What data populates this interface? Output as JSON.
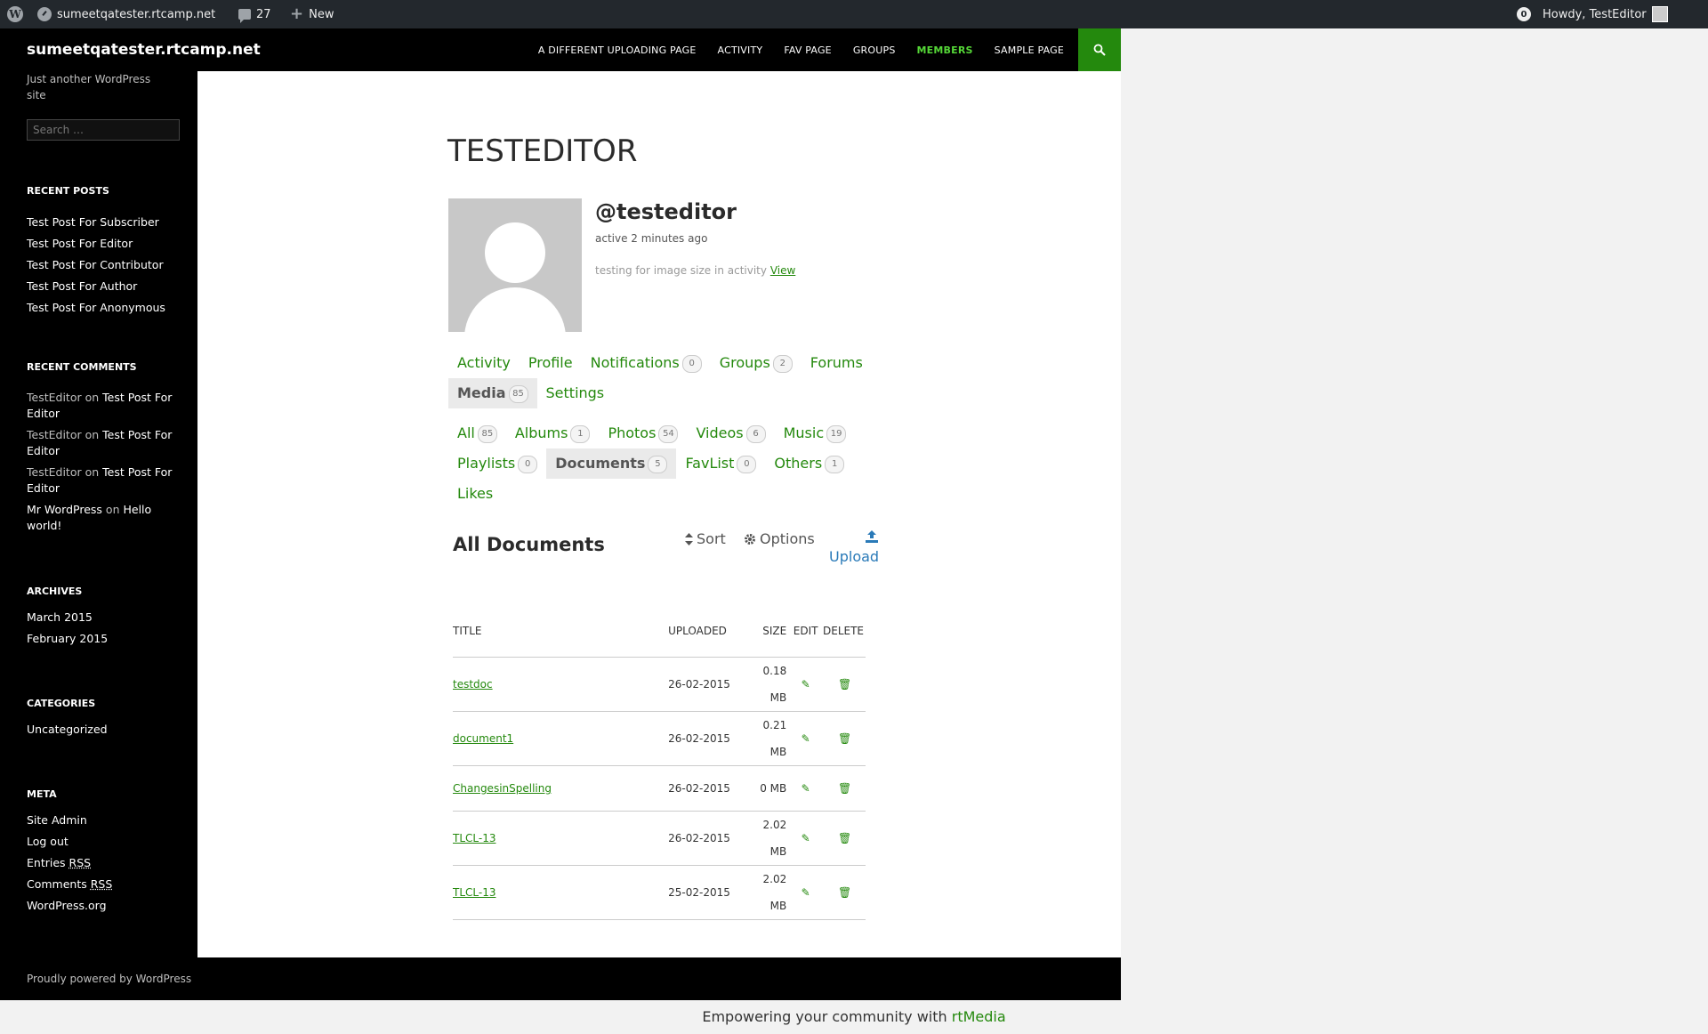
{
  "adminbar": {
    "site_name": "sumeetqatester.rtcamp.net",
    "comments_count": "27",
    "new_label": "New",
    "notifications_count": "0",
    "howdy": "Howdy, TestEditor"
  },
  "header": {
    "site_title": "sumeetqatester.rtcamp.net",
    "nav": [
      "A DIFFERENT UPLOADING PAGE",
      "ACTIVITY",
      "FAV PAGE",
      "GROUPS",
      "MEMBERS",
      "SAMPLE PAGE"
    ],
    "active_nav": "MEMBERS"
  },
  "sidebar": {
    "tagline": "Just another WordPress site",
    "search_placeholder": "Search …",
    "recent_posts_title": "RECENT POSTS",
    "recent_posts": [
      "Test Post For Subscriber",
      "Test Post For Editor",
      "Test Post For Contributor",
      "Test Post For Author",
      "Test Post For Anonymous"
    ],
    "recent_comments_title": "RECENT COMMENTS",
    "recent_comments": [
      {
        "author": "TestEditor",
        "on": "on",
        "post": "Test Post For Editor"
      },
      {
        "author": "TestEditor",
        "on": "on",
        "post": "Test Post For Editor"
      },
      {
        "author": "TestEditor",
        "on": "on",
        "post": "Test Post For Editor"
      },
      {
        "author": "Mr WordPress",
        "on": "on",
        "post": "Hello world!"
      }
    ],
    "archives_title": "ARCHIVES",
    "archives": [
      "March 2015",
      "February 2015"
    ],
    "categories_title": "CATEGORIES",
    "categories": [
      "Uncategorized"
    ],
    "meta_title": "META",
    "meta": {
      "site_admin": "Site Admin",
      "log_out": "Log out",
      "entries": "Entries",
      "comments": "Comments",
      "rss": "RSS",
      "wordpress_org": "WordPress.org"
    }
  },
  "profile": {
    "page_title": "TESTEDITOR",
    "username": "@testeditor",
    "activity_time": "active 2 minutes ago",
    "latest_update": "testing for image size in activity",
    "view_link": "View"
  },
  "main_tabs": [
    {
      "label": "Activity"
    },
    {
      "label": "Profile"
    },
    {
      "label": "Notifications",
      "count": "0"
    },
    {
      "label": "Groups",
      "count": "2"
    },
    {
      "label": "Forums"
    },
    {
      "label": "Media",
      "count": "85",
      "current": true
    },
    {
      "label": "Settings"
    }
  ],
  "media_tabs": [
    {
      "label": "All",
      "count": "85"
    },
    {
      "label": "Albums",
      "count": "1"
    },
    {
      "label": "Photos",
      "count": "54"
    },
    {
      "label": "Videos",
      "count": "6"
    },
    {
      "label": "Music",
      "count": "19"
    },
    {
      "label": "Playlists",
      "count": "0"
    },
    {
      "label": "Documents",
      "count": "5",
      "current": true
    },
    {
      "label": "FavList",
      "count": "0"
    },
    {
      "label": "Others",
      "count": "1"
    },
    {
      "label": "Likes"
    }
  ],
  "gallery": {
    "title": "All Documents",
    "sort_label": "Sort",
    "options_label": "Options",
    "upload_label": "Upload"
  },
  "table": {
    "headers": {
      "title": "TITLE",
      "uploaded": "UPLOADED",
      "size": "SIZE",
      "edit": "EDIT",
      "delete": "DELETE"
    },
    "rows": [
      {
        "title": "testdoc",
        "uploaded": "26-02-2015",
        "size_num": "0.18",
        "size_unit": "MB"
      },
      {
        "title": "document1",
        "uploaded": "26-02-2015",
        "size_num": "0.21",
        "size_unit": "MB"
      },
      {
        "title": "ChangesinSpelling",
        "uploaded": "26-02-2015",
        "size_num": "0 MB",
        "size_unit": ""
      },
      {
        "title": "TLCL-13",
        "uploaded": "26-02-2015",
        "size_num": "2.02",
        "size_unit": "MB"
      },
      {
        "title": "TLCL-13",
        "uploaded": "25-02-2015",
        "size_num": "2.02",
        "size_unit": "MB"
      }
    ]
  },
  "footer": {
    "powered": "Proudly powered by WordPress",
    "rtmedia_prefix": "Empowering your community with",
    "rtmedia_link": "rtMedia"
  },
  "colors": {
    "accent": "#24890d",
    "nav_active": "#55d737",
    "adminbar": "#23282d",
    "upload": "#2a7ab8"
  }
}
